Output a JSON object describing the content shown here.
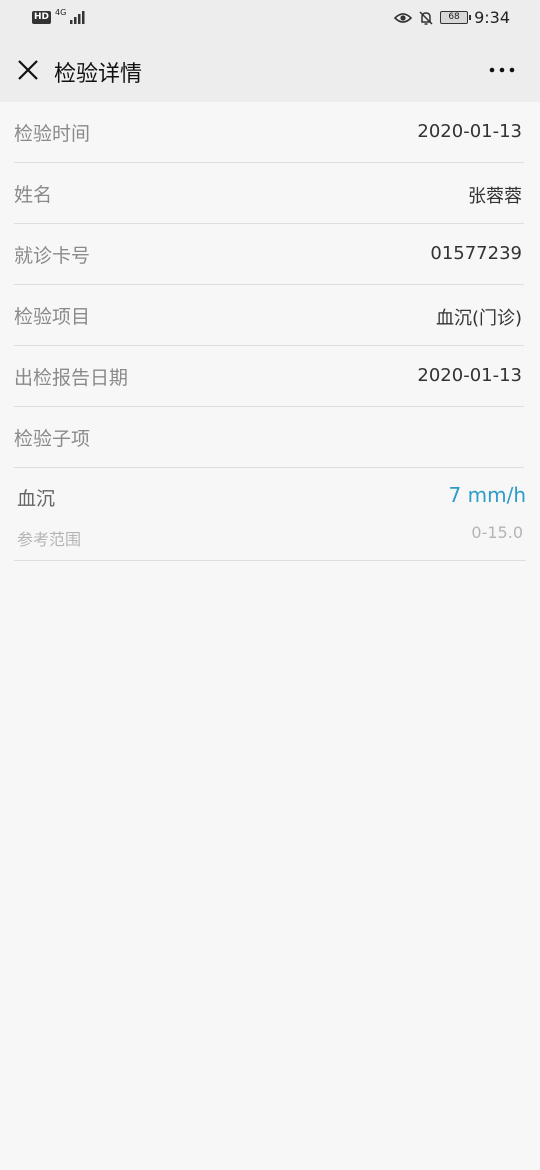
{
  "status_bar": {
    "hd_badge": "HD",
    "network": "4G",
    "battery": "68",
    "time": "9:34",
    "icons": [
      "signal-icon",
      "eye-icon",
      "bell-off-icon",
      "battery-icon"
    ]
  },
  "header": {
    "title": "检验详情",
    "close_icon": "close-icon",
    "more_icon": "more-icon"
  },
  "details": [
    {
      "label": "检验时间",
      "value": "2020-01-13"
    },
    {
      "label": "姓名",
      "value": "张蓉蓉"
    },
    {
      "label": "就诊卡号",
      "value": "01577239"
    },
    {
      "label": "检验项目",
      "value": "血沉(门诊)"
    },
    {
      "label": "出检报告日期",
      "value": "2020-01-13"
    },
    {
      "label": "检验子项",
      "value": ""
    }
  ],
  "sub_items": [
    {
      "name": "血沉",
      "value": "7 mm/h",
      "ref_label": "参考范围",
      "ref_value": "0-15.0"
    }
  ],
  "colors": {
    "accent": "#2d9cc8",
    "header_bg": "#ededed",
    "page_bg": "#f7f7f7"
  }
}
